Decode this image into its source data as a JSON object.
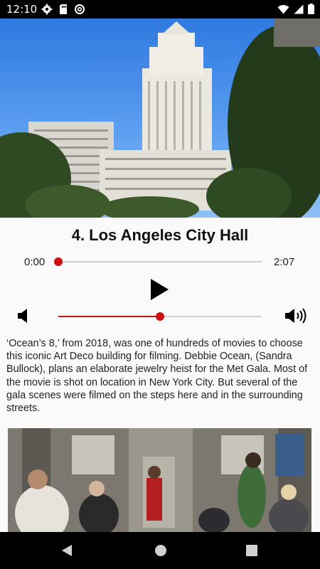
{
  "status_bar": {
    "time": "12:10",
    "left_icons": [
      "gear-icon",
      "sd-card-icon",
      "data-saver-icon"
    ],
    "right_icons": [
      "wifi-icon",
      "signal-icon",
      "battery-icon"
    ]
  },
  "hero_image": {
    "subject": "Los Angeles City Hall tower against blue sky"
  },
  "track": {
    "title": "4. Los Angeles City Hall"
  },
  "player": {
    "current_time": "0:00",
    "total_time": "2:07",
    "progress": 0.0,
    "volume": 0.5,
    "play_icon": "play-icon",
    "volume_down_icon": "volume-mute-icon",
    "volume_up_icon": "volume-up-icon"
  },
  "description": "‘Ocean’s 8,’ from 2018, was one of hundreds of movies to choose this iconic Art Deco building for filming. Debbie Ocean, (Sandra Bullock), plans an elaborate jewelry heist for the Met Gala. Most of the movie is shot on location in New York City. But several of the gala scenes were filmed on the steps here and in the surrounding streets.",
  "second_image": {
    "subject": "Ocean's 8 cast seated in a subway car"
  },
  "nav_bar": {
    "buttons": [
      "back-icon",
      "home-icon",
      "recents-icon"
    ]
  },
  "colors": {
    "accent": "#d01010",
    "status_bar": "#000000",
    "background": "#fafafa"
  }
}
